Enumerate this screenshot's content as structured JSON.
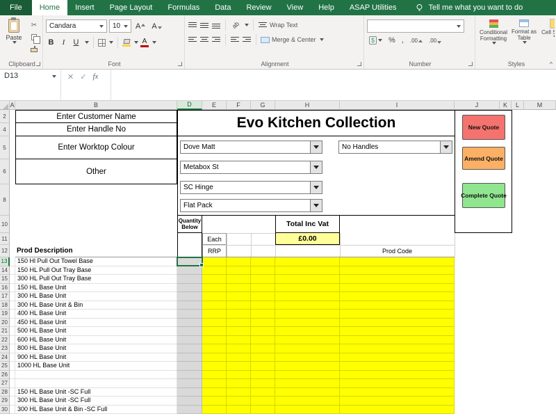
{
  "tabs": {
    "items": [
      {
        "label": "File",
        "type": "file"
      },
      {
        "label": "Home",
        "active": true
      },
      {
        "label": "Insert"
      },
      {
        "label": "Page Layout"
      },
      {
        "label": "Formulas"
      },
      {
        "label": "Data"
      },
      {
        "label": "Review"
      },
      {
        "label": "View"
      },
      {
        "label": "Help"
      },
      {
        "label": "ASAP Utilities"
      }
    ],
    "tell_me": "Tell me what you want to do"
  },
  "ribbon": {
    "clipboard": {
      "label": "Clipboard",
      "paste_label": "Paste",
      "cut_icon": "✂"
    },
    "font": {
      "label": "Font",
      "font_name": "Candara",
      "font_size": "10",
      "bold_icon": "B",
      "italic_icon": "I",
      "underline_icon": "U",
      "grow_icon": "A",
      "shrink_icon": "A",
      "font_color_icon": "A"
    },
    "alignment": {
      "label": "Alignment",
      "wrap_label": "Wrap Text",
      "merge_label": "Merge & Center",
      "orientation_icon": "ab"
    },
    "number": {
      "label": "Number",
      "format_value": "",
      "currency_icon": "$",
      "percent_icon": "%",
      "comma_icon": ",",
      "decimal_icon": ".00"
    },
    "styles": {
      "label": "Styles",
      "conditional_label": "Conditional Formatting",
      "table_label": "Format as Table",
      "cells_label": "Cell Styles"
    }
  },
  "formula": {
    "name_box": "D13",
    "cancel_icon": "✕",
    "enter_icon": "✓",
    "fx_icon": "fx"
  },
  "sheet": {
    "columns": [
      "A",
      "B",
      "D",
      "E",
      "F",
      "G",
      "H",
      "I",
      "J",
      "K",
      "L",
      "M"
    ],
    "top_rows": [
      "2",
      "4",
      "5",
      "6",
      "8",
      "10",
      "11",
      "12"
    ],
    "selected": {
      "cell": "D13",
      "column": "D",
      "row": "13"
    },
    "form": {
      "customer_label": "Enter Customer Name",
      "handle_label": "Enter Handle No",
      "worktop_label": "Enter Worktop Colour",
      "other_label": "Other",
      "title": "Evo Kitchen Collection",
      "worktop_value": "Dove Matt",
      "handles_value": "No Handles",
      "drawer_value": "Metabox St",
      "hinge_value": "SC Hinge",
      "pack_value": "Flat Pack"
    },
    "actions": {
      "new": "New Quote",
      "amend": "Amend Quote",
      "complete": "Complete Quote"
    },
    "table": {
      "quantity_header": "Quantity Below",
      "each": "Each",
      "rrp": "RRP",
      "total_header": "Total Inc Vat",
      "total_value": "£0.00",
      "desc_header": "Prod Description",
      "code_header": "Prod Code",
      "rows": [
        {
          "n": "13",
          "desc": "150 Hl Pull Out Towel Base"
        },
        {
          "n": "14",
          "desc": "150 HL Pull Out Tray Base"
        },
        {
          "n": "15",
          "desc": "300 HL Pull Out Tray Base"
        },
        {
          "n": "16",
          "desc": "150 HL Base Unit"
        },
        {
          "n": "17",
          "desc": "300 HL Base Unit"
        },
        {
          "n": "18",
          "desc": "300 HL Base Unit & Bin"
        },
        {
          "n": "19",
          "desc": "400 HL Base Unit"
        },
        {
          "n": "20",
          "desc": "450 HL Base Unit"
        },
        {
          "n": "21",
          "desc": "500 HL Base Unit"
        },
        {
          "n": "22",
          "desc": "600 HL Base Unit"
        },
        {
          "n": "23",
          "desc": "800 HL Base Unit"
        },
        {
          "n": "24",
          "desc": "900 HL Base Unit"
        },
        {
          "n": "25",
          "desc": "1000 HL Base Unit"
        },
        {
          "n": "26",
          "desc": ""
        },
        {
          "n": "27",
          "desc": ""
        },
        {
          "n": "28",
          "desc": "150 HL Base Unit -SC Full"
        },
        {
          "n": "29",
          "desc": "300 HL Base Unit -SC Full"
        },
        {
          "n": "30",
          "desc": "300 HL Base Unit & Bin -SC Full"
        }
      ]
    }
  },
  "colors": {
    "excel_green": "#217346",
    "highlight_yellow": "#ffff00",
    "total_yellow": "#ffff99",
    "quantity_gray": "#d9d9d9",
    "new_quote_red": "#f4736e",
    "amend_quote_orange": "#fbb065",
    "complete_quote_green": "#8fe68f"
  }
}
